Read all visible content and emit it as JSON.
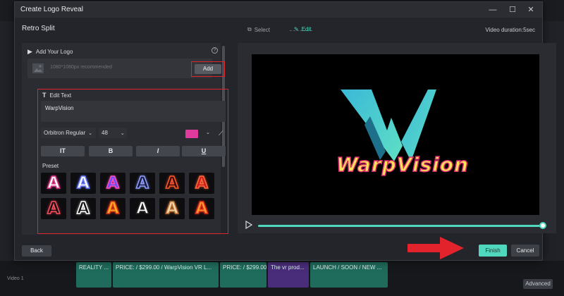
{
  "dialog": {
    "title": "Create Logo Reveal",
    "template_name": "Retro Split",
    "steps": [
      {
        "label": "Select"
      },
      {
        "label": "Edit"
      }
    ],
    "duration": "Video duration:5sec"
  },
  "logo_section": {
    "heading": "Add Your Logo",
    "hint": "1080*1080px recommended",
    "add_label": "Add"
  },
  "text_section": {
    "heading": "Edit Text",
    "text_value": "WarpVision",
    "font": "Orbitron Regular",
    "size": "48",
    "color": "#e13a9d",
    "preset_label": "Preset",
    "style_buttons": [
      "IT",
      "B",
      "I",
      "U"
    ]
  },
  "presets": [
    {
      "letter": "A",
      "fill": "#ffffff",
      "stroke": "#e03a8c"
    },
    {
      "letter": "A",
      "fill": "#ffffff",
      "stroke": "#6b7cff"
    },
    {
      "letter": "A",
      "fill": "#6a4dff",
      "stroke": "#ff4db8"
    },
    {
      "letter": "A",
      "fill": "#1a1a40",
      "stroke": "#8fa0ff"
    },
    {
      "letter": "A",
      "fill": "#3a0a0a",
      "stroke": "#ff5a2a"
    },
    {
      "letter": "A",
      "fill": "#c82020",
      "stroke": "#ff6a3a"
    },
    {
      "letter": "A",
      "fill": "#111111",
      "stroke": "#ff4d5d"
    },
    {
      "letter": "A",
      "fill": "#111111",
      "stroke": "#ffffff"
    },
    {
      "letter": "A",
      "fill": "#ffb020",
      "stroke": "#e0381a"
    },
    {
      "letter": "A",
      "fill": "#ffffff",
      "stroke": "#222222"
    },
    {
      "letter": "A",
      "fill": "#f0d8b0",
      "stroke": "#c07030"
    },
    {
      "letter": "A",
      "fill": "#ff9a30",
      "stroke": "#e02a1a"
    }
  ],
  "preview": {
    "logo_text": "WarpVision",
    "accent": "#4fd8bd"
  },
  "footer": {
    "back": "Back",
    "finish": "Finish",
    "cancel": "Cancel"
  },
  "timeline": {
    "clips": [
      {
        "text": "REALITY ..."
      },
      {
        "text": "PRICE: / $299.00 / WarpVision VR L..."
      },
      {
        "text": "PRICE: / $299.00"
      },
      {
        "text": "The vr prod..."
      },
      {
        "text": "LAUNCH / SOON / NEW ..."
      }
    ],
    "track_label": "Video 1",
    "advanced": "Advanced"
  }
}
